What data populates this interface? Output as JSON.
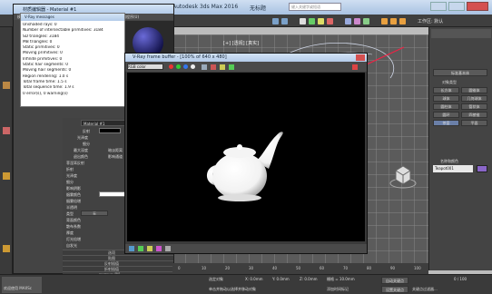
{
  "app": {
    "title": "Autodesk 3ds Max 2016",
    "file": "无标题",
    "workspace": "工作区: 默认",
    "search_placeholder": "键入关键字或短语"
  },
  "material_editor": {
    "title": "材质编辑器 - Material #1",
    "menu": [
      "模式(D)",
      "材质(M)",
      "导航(N)",
      "选项(O)",
      "实用程序(U)"
    ],
    "material_name": "Material #1",
    "material_type": "VRayMtl"
  },
  "stats": {
    "title": "V-Ray messages",
    "lines": [
      "Unshaded rays: 0",
      "Number of intersectable primitives: 3184",
      "SD triangles: 3184",
      "MB triangles: 0",
      "Static primitives: 0",
      "Moving primitives: 0",
      "Infinite primitives: 0",
      "Static hair segments: 0",
      "Moving hair segments: 0",
      "Region rendering: 1.0 s",
      "Total frame time: 1.5 s",
      "Total sequence time: 1.9 s",
      "0 error(s), 0 warning(s)"
    ]
  },
  "vfb": {
    "title": "V-Ray frame buffer - [100% of 640 x 480]",
    "channel": "RGB color"
  },
  "params": {
    "labels": [
      "反射",
      "光泽度",
      "细分",
      "最大深度",
      "退出颜色",
      "菲涅耳反射",
      "折射",
      "光泽度",
      "细分",
      "影响阴影",
      "烟雾颜色",
      "烟雾倍增",
      "半透明",
      "类型",
      "背面颜色",
      "散布系数",
      "厚度",
      "灯光倍增",
      "自发光",
      "BRDF",
      "各向异性",
      "旋转"
    ],
    "reflect_opts": [
      "暗淡距离",
      "影响通道"
    ],
    "type_value": "无",
    "brdf": "双向反射分布函数",
    "brdf_type": "反射",
    "aniso": "局部轴",
    "rollouts": [
      "选项",
      "贴图",
      "反射插值",
      "折射插值",
      "mental ray 连接"
    ]
  },
  "right_panel": {
    "title": "标准基本体",
    "group_title": "对象类型",
    "buttons": [
      "长方体",
      "圆锥体",
      "球体",
      "几何球体",
      "圆柱体",
      "管状体",
      "圆环",
      "四棱锥",
      "茶壶",
      "平面"
    ],
    "name_section": "名称和颜色",
    "object_name": "Teapot001"
  },
  "status": {
    "lines": [
      "欢迎使用 MAXSc",
      "单击并拖动以选择并移动对象"
    ],
    "coords": [
      "X: 0.0mm",
      "Y: 0.0mm",
      "Z: 0.0mm"
    ],
    "grid": "栅格 = 10.0mm",
    "frame": "0 / 100",
    "addtime": "添加时间标记",
    "autokey": "自动关键点",
    "setkey": "设置关键点",
    "select": "选定对象",
    "filter": "关键点过滤器..."
  },
  "timeline": {
    "ticks": [
      "0",
      "10",
      "20",
      "30",
      "40",
      "50",
      "60",
      "70",
      "80",
      "90",
      "100"
    ]
  },
  "viewport_label": "[+] [透视] [真实]"
}
